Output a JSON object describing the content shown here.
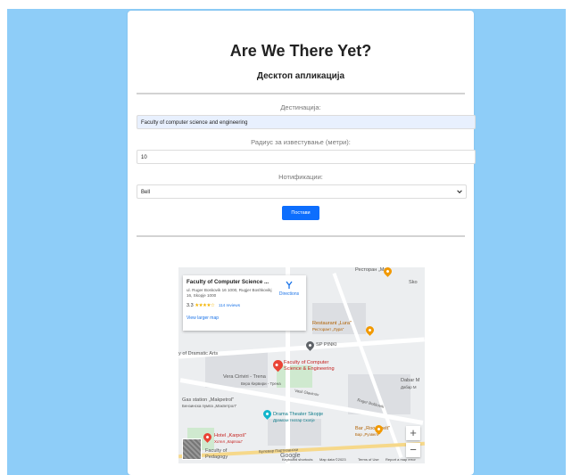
{
  "header": {
    "title": "Are We There Yet?",
    "subtitle": "Десктоп апликација"
  },
  "form": {
    "destination_label": "Дестинација:",
    "destination_value": "Faculty of computer science and engineering",
    "radius_label": "Радиус за известување (метри):",
    "radius_value": "10",
    "notification_label": "Нотификации:",
    "notification_value": "Bell",
    "submit_label": "Постави"
  },
  "map": {
    "info": {
      "title": "Faculty of Computer Science ...",
      "address": "ul. Ruger Boskovik 16 1000, Rugjer Boshkovikj 16, Skopje 1000",
      "rating": "3.3",
      "stars": "★★★★☆",
      "reviews": "114 reviews",
      "larger_map": "View larger map",
      "directions": "Directions"
    },
    "labels": {
      "restaurant_lura": "Restaurant „Lura\"",
      "restaurant_lura_cyr": "Ресторант „Лура\"",
      "fp_pinki": "SP PINKI",
      "dramatic_arts": "y of Dramatic Arts",
      "faculty_pin": "Faculty of Computer Science & Engineering",
      "vera_ciriviri": "Vera Ciriviri - Trena",
      "vera_cyr": "Вера Ќирвири - Трена",
      "gas_station": "Gas station „Makpetrol\"",
      "gas_station_cyr": "Бензинска пумпа „Макпетрол\"",
      "drama_theater": "Drama Theater Skopje",
      "drama_theater_cyr": "Драмски театар Скопје",
      "hotel_karpos": "Hotel „Karpoš\"",
      "hotel_karpos_cyr": "Хотел „Карпош\"",
      "bar_roosevelt": "Bar „Roosevelt\"",
      "bar_roosevelt_cyr": "Бар „Рузвелт\"",
      "pedagogy": "Faculty of Pedagogy",
      "dabar": "Dabar M",
      "dabar_cyr": "Дабар М",
      "skopje_part": "Sko",
      "restoran_top": "Ресторан „Mo\"",
      "street_vasil": "Vasil Glavinov",
      "street_rudjer": "Ruger Boškovik",
      "street_bulevar": "Булевар Партизански",
      "google": "Google"
    },
    "footer": {
      "shortcuts": "Keyboard shortcuts",
      "mapdata": "Map data ©2023",
      "terms": "Terms of Use",
      "report": "Report a map error"
    },
    "zoom_in": "+",
    "zoom_out": "−"
  },
  "colors": {
    "background": "#8ecdf8",
    "button": "#0d6efd",
    "autofill": "#e8f0fe",
    "pin": "#ea4335"
  },
  "icons": {
    "select_arrow": "chevron-down-icon",
    "directions": "directions-icon",
    "map_pin": "location-pin-icon"
  }
}
